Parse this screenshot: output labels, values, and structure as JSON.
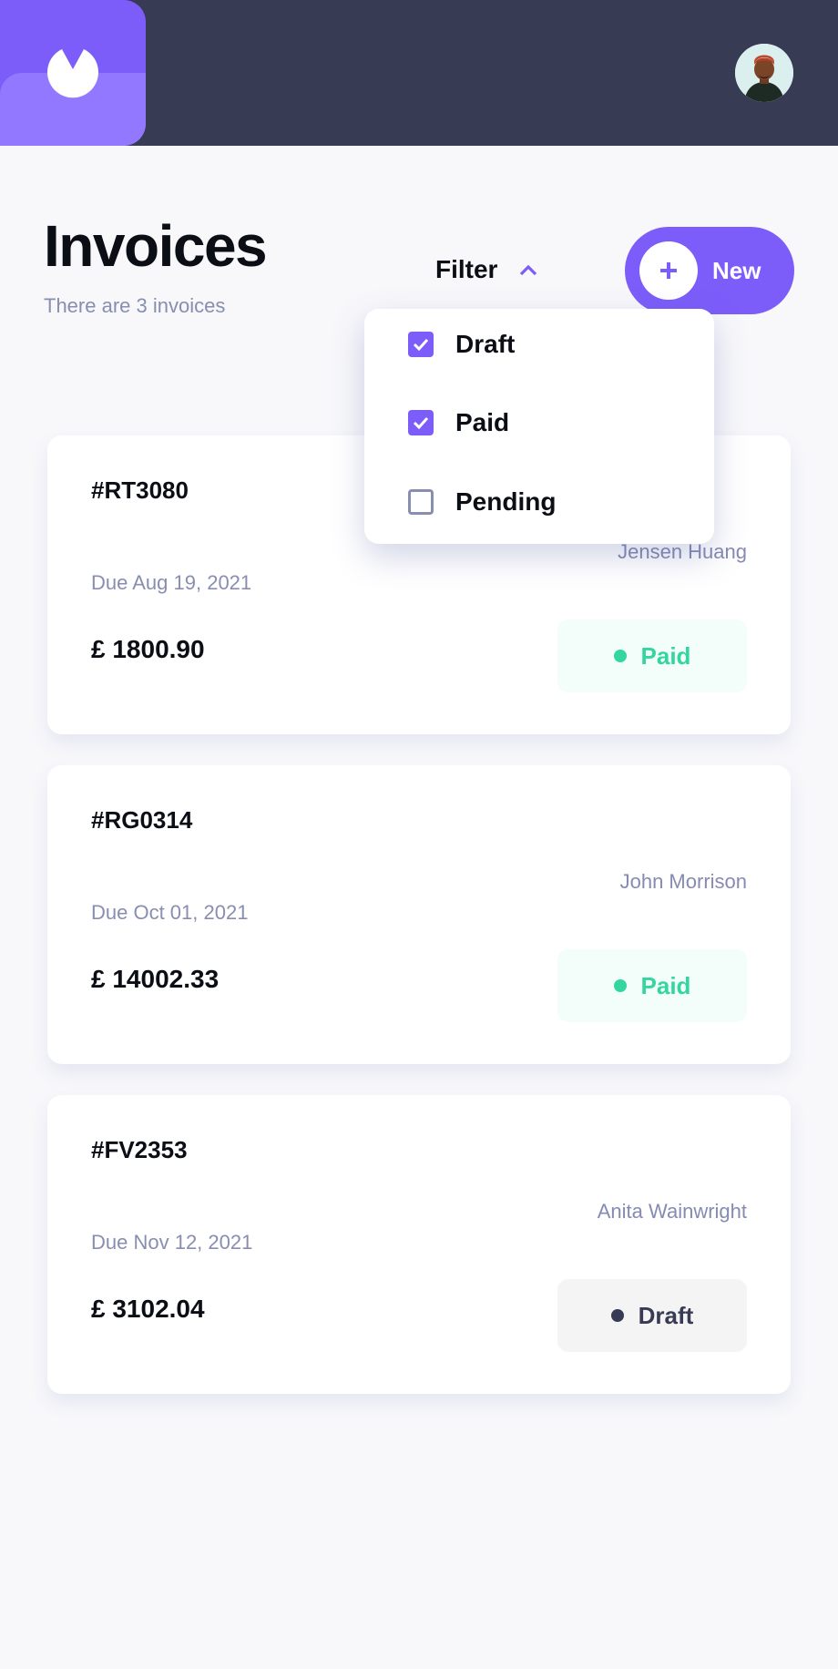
{
  "header": {
    "logo_icon": "app-logo-icon",
    "avatar_icon": "user-avatar"
  },
  "page": {
    "title": "Invoices",
    "subtitle": "There are 3 invoices"
  },
  "filter": {
    "label": "Filter",
    "expanded": true,
    "icon": "chevron-up-icon",
    "options": [
      {
        "label": "Draft",
        "checked": true
      },
      {
        "label": "Paid",
        "checked": true
      },
      {
        "label": "Pending",
        "checked": false
      }
    ]
  },
  "new_button": {
    "label": "New",
    "icon": "plus-icon"
  },
  "invoices": [
    {
      "id": "#RT3080",
      "client": "Jensen Huang",
      "due": "Due Aug 19, 2021",
      "amount": "£ 1800.90",
      "status": "Paid"
    },
    {
      "id": "#RG0314",
      "client": "John Morrison",
      "due": "Due Oct 01, 2021",
      "amount": "£ 14002.33",
      "status": "Paid"
    },
    {
      "id": "#FV2353",
      "client": "Anita Wainwright",
      "due": "Due Nov 12, 2021",
      "amount": "£ 3102.04",
      "status": "Draft"
    }
  ],
  "colors": {
    "accent": "#7C5DFA",
    "accent_light": "#9277FF",
    "header_bg": "#373B53",
    "page_bg": "#F8F8FB",
    "muted_text": "#888EB0",
    "paid": "#33D69F",
    "draft": "#373B53"
  }
}
